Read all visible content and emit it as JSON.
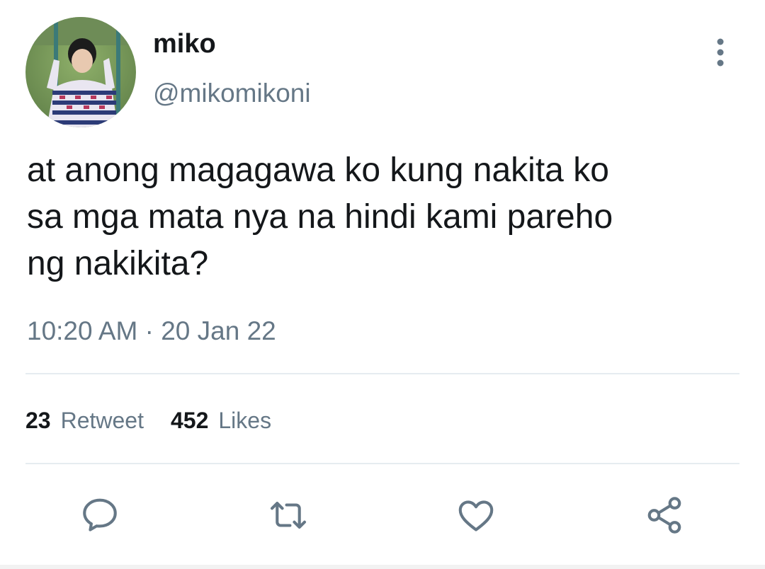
{
  "user": {
    "display_name": "miko",
    "handle": "@mikomikoni",
    "avatar": "profile-photo"
  },
  "tweet": {
    "text": "at anong magagawa ko kung nakita ko\nsa mga mata nya na hindi kami pareho\nng nakikita?",
    "timestamp": "10:20 AM · 20 Jan 22"
  },
  "stats": {
    "retweets_count": "23",
    "retweets_label": "Retweet",
    "likes_count": "452",
    "likes_label": "Likes"
  },
  "actions": {
    "reply_icon": "speech-bubble",
    "retweet_icon": "retweet-arrows",
    "like_icon": "heart",
    "share_icon": "share-nodes",
    "more_icon": "vertical-ellipsis"
  },
  "colors": {
    "primary_text": "#14171a",
    "secondary_text": "#657786",
    "divider": "#e6ecf0"
  }
}
